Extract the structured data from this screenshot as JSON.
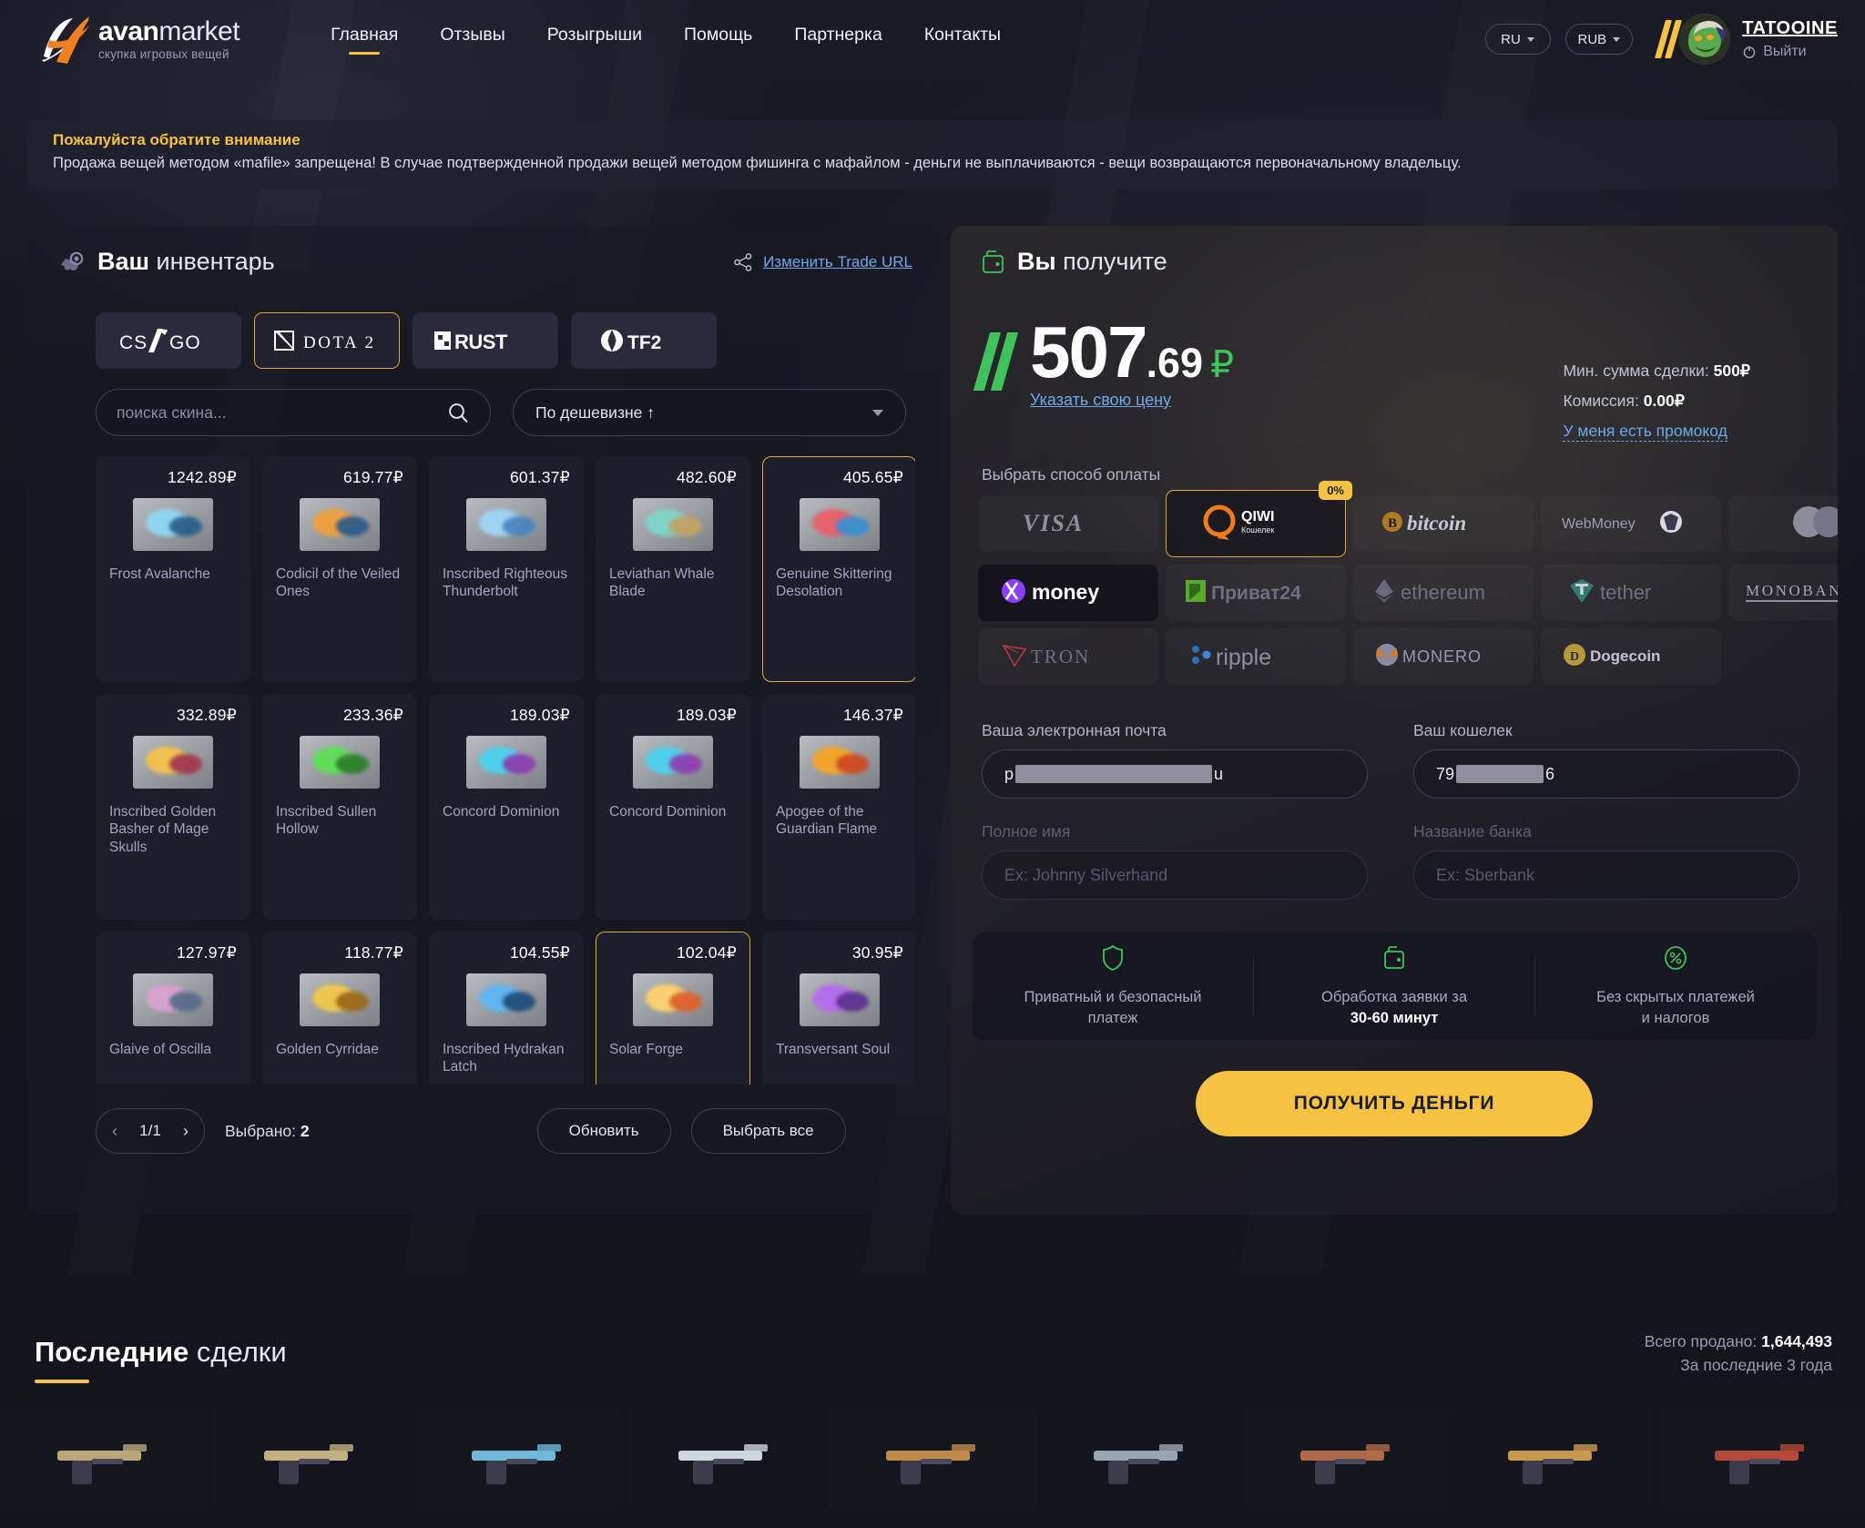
{
  "brand": {
    "name_bold": "avan",
    "name_light": "market",
    "tagline": "скупка игровых вещей"
  },
  "nav": {
    "items": [
      {
        "label": "Главная",
        "active": true
      },
      {
        "label": "Отзывы",
        "active": false
      },
      {
        "label": "Розыгрыши",
        "active": false
      },
      {
        "label": "Помощь",
        "active": false
      },
      {
        "label": "Партнерка",
        "active": false
      },
      {
        "label": "Контакты",
        "active": false
      }
    ]
  },
  "header": {
    "language": "RU",
    "currency": "RUB",
    "username": "TATOOINE",
    "logout_label": "Выйти"
  },
  "notice": {
    "title": "Пожалуйста обратите внимание",
    "body": "Продажа вещей методом «mafile» запрещена! В случае подтвержденной продажи вещей методом фишинга с мафайлом - деньги не выплачиваются - вещи возвращаются первоначальному владельцу."
  },
  "inventory": {
    "title_bold": "Ваш",
    "title_light": "инвентарь",
    "trade_url_label": "Изменить Trade URL",
    "games": [
      {
        "label": "CS:GO",
        "id": "csgo",
        "active": false
      },
      {
        "label": "DOTA 2",
        "id": "dota2",
        "active": true
      },
      {
        "label": "RUST",
        "id": "rust",
        "active": false
      },
      {
        "label": "TF2",
        "id": "tf2",
        "active": false
      }
    ],
    "search_placeholder": "поиска скина...",
    "search_value": "",
    "sort_label": "По дешевизне ↑",
    "items": [
      {
        "price": "1242.89₽",
        "name": "Frost Avalanche",
        "selected": false,
        "c1": "#8fd8f5",
        "c2": "#2a5f8a"
      },
      {
        "price": "619.77₽",
        "name": "Codicil of the Veiled Ones",
        "selected": false,
        "c1": "#f0a03c",
        "c2": "#2f5d86"
      },
      {
        "price": "601.37₽",
        "name": "Inscribed Righteous Thunderbolt",
        "selected": false,
        "c1": "#9fd6f7",
        "c2": "#4b86bd"
      },
      {
        "price": "482.60₽",
        "name": "Leviathan Whale Blade",
        "selected": false,
        "c1": "#7fd6c8",
        "c2": "#c3a263"
      },
      {
        "price": "405.65₽",
        "name": "Genuine Skittering Desolation",
        "selected": true,
        "c1": "#e8606a",
        "c2": "#3b8fd0"
      },
      {
        "price": "332.89₽",
        "name": "Inscribed Golden Basher of Mage Skulls",
        "selected": false,
        "c1": "#f2c44a",
        "c2": "#a33a4f"
      },
      {
        "price": "233.36₽",
        "name": "Inscribed Sullen Hollow",
        "selected": false,
        "c1": "#5ddf55",
        "c2": "#2f7f2a"
      },
      {
        "price": "189.03₽",
        "name": "Concord Dominion",
        "selected": false,
        "c1": "#4ad2ef",
        "c2": "#8d3fb0"
      },
      {
        "price": "189.03₽",
        "name": "Concord Dominion",
        "selected": false,
        "c1": "#4ad2ef",
        "c2": "#8d3fb0"
      },
      {
        "price": "146.37₽",
        "name": "Apogee of the Guardian Flame",
        "selected": false,
        "c1": "#f5a623",
        "c2": "#d04a1f"
      },
      {
        "price": "127.97₽",
        "name": "Glaive of Oscilla",
        "selected": false,
        "c1": "#d9a3d1",
        "c2": "#5a6c88"
      },
      {
        "price": "118.77₽",
        "name": "Golden Cyrridae",
        "selected": false,
        "c1": "#f3c84b",
        "c2": "#9a6a18"
      },
      {
        "price": "104.55₽",
        "name": "Inscribed Hydrakan Latch",
        "selected": false,
        "c1": "#5fb6f0",
        "c2": "#1f4f7d"
      },
      {
        "price": "102.04₽",
        "name": "Solar Forge",
        "selected": true,
        "c1": "#ffd36b",
        "c2": "#e0622d"
      },
      {
        "price": "30.95₽",
        "name": "Transversant Soul",
        "selected": false,
        "c1": "#b56bf0",
        "c2": "#5d3590"
      }
    ],
    "page": "1/1",
    "selected_label": "Выбрано:",
    "selected_count": "2",
    "refresh_label": "Обновить",
    "select_all_label": "Выбрать все"
  },
  "payout": {
    "title_bold": "Вы",
    "title_light": "получите",
    "amount_int": "507",
    "amount_dec": ".69",
    "currency": "₽",
    "custom_price_link": "Указать свою цену",
    "min_deal_label": "Мин. сумма сделки:",
    "min_deal_value": "500₽",
    "commission_label": "Комиссия:",
    "commission_value": "0.00₽",
    "promo_link": "У меня есть промокод",
    "pay_methods_label": "Выбрать способ оплаты",
    "methods": [
      {
        "id": "visa",
        "label": "VISA",
        "selected": false,
        "badge": "",
        "dark": false
      },
      {
        "id": "qiwi",
        "label": "QIWI Кошелек",
        "selected": true,
        "badge": "0%",
        "dark": false
      },
      {
        "id": "bitcoin",
        "label": "bitcoin",
        "selected": false,
        "badge": "",
        "dark": false
      },
      {
        "id": "webmoney",
        "label": "WebMoney",
        "selected": false,
        "badge": "",
        "dark": false
      },
      {
        "id": "mastercard",
        "label": "Mastercard",
        "selected": false,
        "badge": "",
        "dark": false
      },
      {
        "id": "yoomoney",
        "label": "money",
        "selected": false,
        "badge": "",
        "dark": true
      },
      {
        "id": "privat24",
        "label": "Приват24",
        "selected": false,
        "badge": "",
        "dark": false
      },
      {
        "id": "ethereum",
        "label": "ethereum",
        "selected": false,
        "badge": "",
        "dark": false
      },
      {
        "id": "tether",
        "label": "tether",
        "selected": false,
        "badge": "",
        "dark": false
      },
      {
        "id": "monobank",
        "label": "MONOBANK",
        "selected": false,
        "badge": "",
        "dark": false
      },
      {
        "id": "tron",
        "label": "TRON",
        "selected": false,
        "badge": "",
        "dark": false
      },
      {
        "id": "ripple",
        "label": "ripple",
        "selected": false,
        "badge": "",
        "dark": false
      },
      {
        "id": "monero",
        "label": "MONERO",
        "selected": false,
        "badge": "",
        "dark": false
      },
      {
        "id": "dogecoin",
        "label": "Dogecoin",
        "selected": false,
        "badge": "",
        "dark": false
      }
    ],
    "form": {
      "email_label": "Ваша электронная почта",
      "email_prefix": "p",
      "email_suffix": "u",
      "wallet_label": "Ваш кошелек",
      "wallet_prefix": "79",
      "wallet_suffix": "6",
      "fullname_label": "Полное имя",
      "fullname_placeholder": "Ex: Johnny Silverhand",
      "bank_label": "Название банка",
      "bank_placeholder": "Ex: Sberbank"
    },
    "features": [
      {
        "icon": "shield-icon",
        "line1": "Приватный и безопасный",
        "line2": "платеж",
        "bold2": false
      },
      {
        "icon": "wallet-icon",
        "line1": "Обработка заявки за",
        "line2": "30-60 минут",
        "bold2": true
      },
      {
        "icon": "percent-icon",
        "line1": "Без скрытых платежей",
        "line2": "и налогов",
        "bold2": false
      }
    ],
    "cta_label": "ПОЛУЧИТЬ ДЕНЬГИ"
  },
  "deals": {
    "title_bold": "Последние",
    "title_light": "сделки",
    "total_label": "Всего продано:",
    "total_value": "1,644,493",
    "period": "За последние 3 года"
  },
  "colors": {
    "accent_yellow": "#f5c242",
    "accent_green": "#3ec45a",
    "link_blue": "#6ea8e8",
    "panel_bg": "#1a1a25"
  }
}
